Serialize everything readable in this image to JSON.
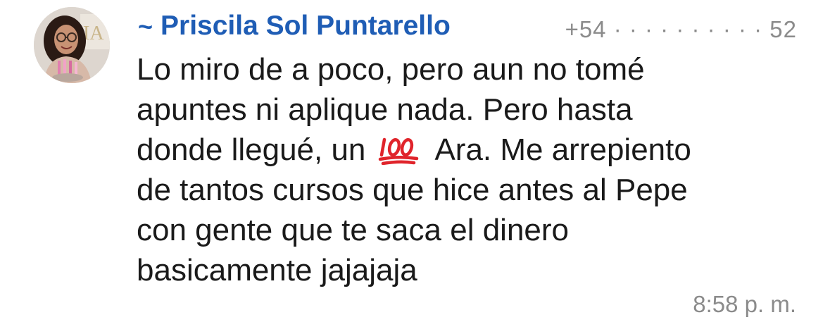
{
  "sender": {
    "prefix": "~",
    "name": "Priscila Sol Puntarello",
    "phone": "+54 · · · · · · · · · · 52",
    "name_color": "#1f5db5"
  },
  "avatar": {
    "icon": "profile-photo"
  },
  "message": {
    "part1": "Lo miro de a poco, pero aun no tomé\napuntes ni aplique nada. Pero hasta\ndonde llegué, un",
    "emoji": "100-emoji",
    "part2": "Ara. Me arrepiento\nde tantos cursos que hice antes al Pepe\ncon gente que te saca el dinero\nbasicamente jajajaja",
    "time": "8:58 p. m."
  },
  "colors": {
    "text": "#1a1a1a",
    "meta": "#8b8b8b",
    "emoji": "#e0242b"
  }
}
